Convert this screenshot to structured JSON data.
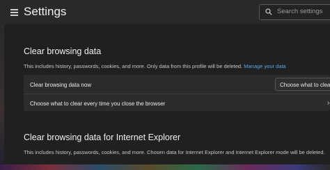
{
  "header": {
    "title": "Settings",
    "search_placeholder": "Search settings"
  },
  "clear_browsing": {
    "heading": "Clear browsing data",
    "description": "This includes history, passwords, cookies, and more. Only data from this profile will be deleted.",
    "manage_link": "Manage your data",
    "row_now_label": "Clear browsing data now",
    "choose_button": "Choose what to clear",
    "row_on_close_label": "Choose what to clear every time you close the browser"
  },
  "clear_ie": {
    "heading": "Clear browsing data for Internet Explorer",
    "description": "This includes history, passwords, cookies, and more. Chosen data for Internet Explorer and Internet Explorer mode will be deleted."
  },
  "icons": {
    "menu": "hamburger-menu-icon",
    "search": "search-icon",
    "chevron": "chevron-right-icon"
  },
  "colors": {
    "link": "#5aa7e8",
    "background": "#202020",
    "card": "#2c2c2c"
  }
}
